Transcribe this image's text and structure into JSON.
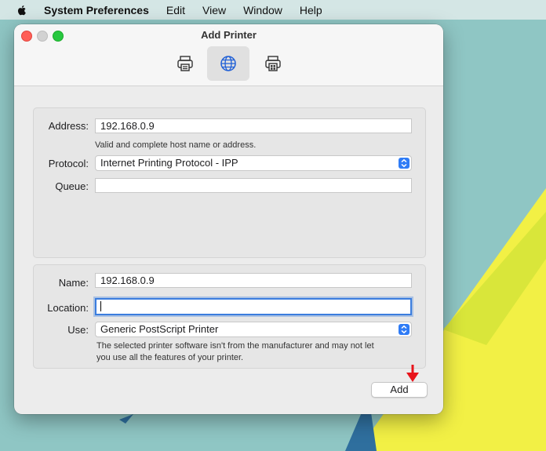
{
  "menubar": {
    "app_name": "System Preferences",
    "items": [
      "Edit",
      "View",
      "Window",
      "Help"
    ]
  },
  "window": {
    "title": "Add Printer",
    "toolbar": [
      {
        "icon": "printer-icon"
      },
      {
        "icon": "globe-icon",
        "selected": true
      },
      {
        "icon": "windows-printer-icon"
      }
    ]
  },
  "form": {
    "address": {
      "label": "Address:",
      "value": "192.168.0.9",
      "hint": "Valid and complete host name or address."
    },
    "protocol": {
      "label": "Protocol:",
      "value": "Internet Printing Protocol - IPP"
    },
    "queue": {
      "label": "Queue:",
      "value": ""
    },
    "name": {
      "label": "Name:",
      "value": "192.168.0.9"
    },
    "location": {
      "label": "Location:",
      "value": ""
    },
    "use": {
      "label": "Use:",
      "value": "Generic PostScript Printer",
      "hint_line1": "The selected printer software isn't from the manufacturer and may not let",
      "hint_line2": "you use all the features of your printer."
    }
  },
  "buttons": {
    "add": "Add"
  },
  "colors": {
    "accent": "#2f7cf6",
    "annotation_arrow": "#e8141b"
  }
}
